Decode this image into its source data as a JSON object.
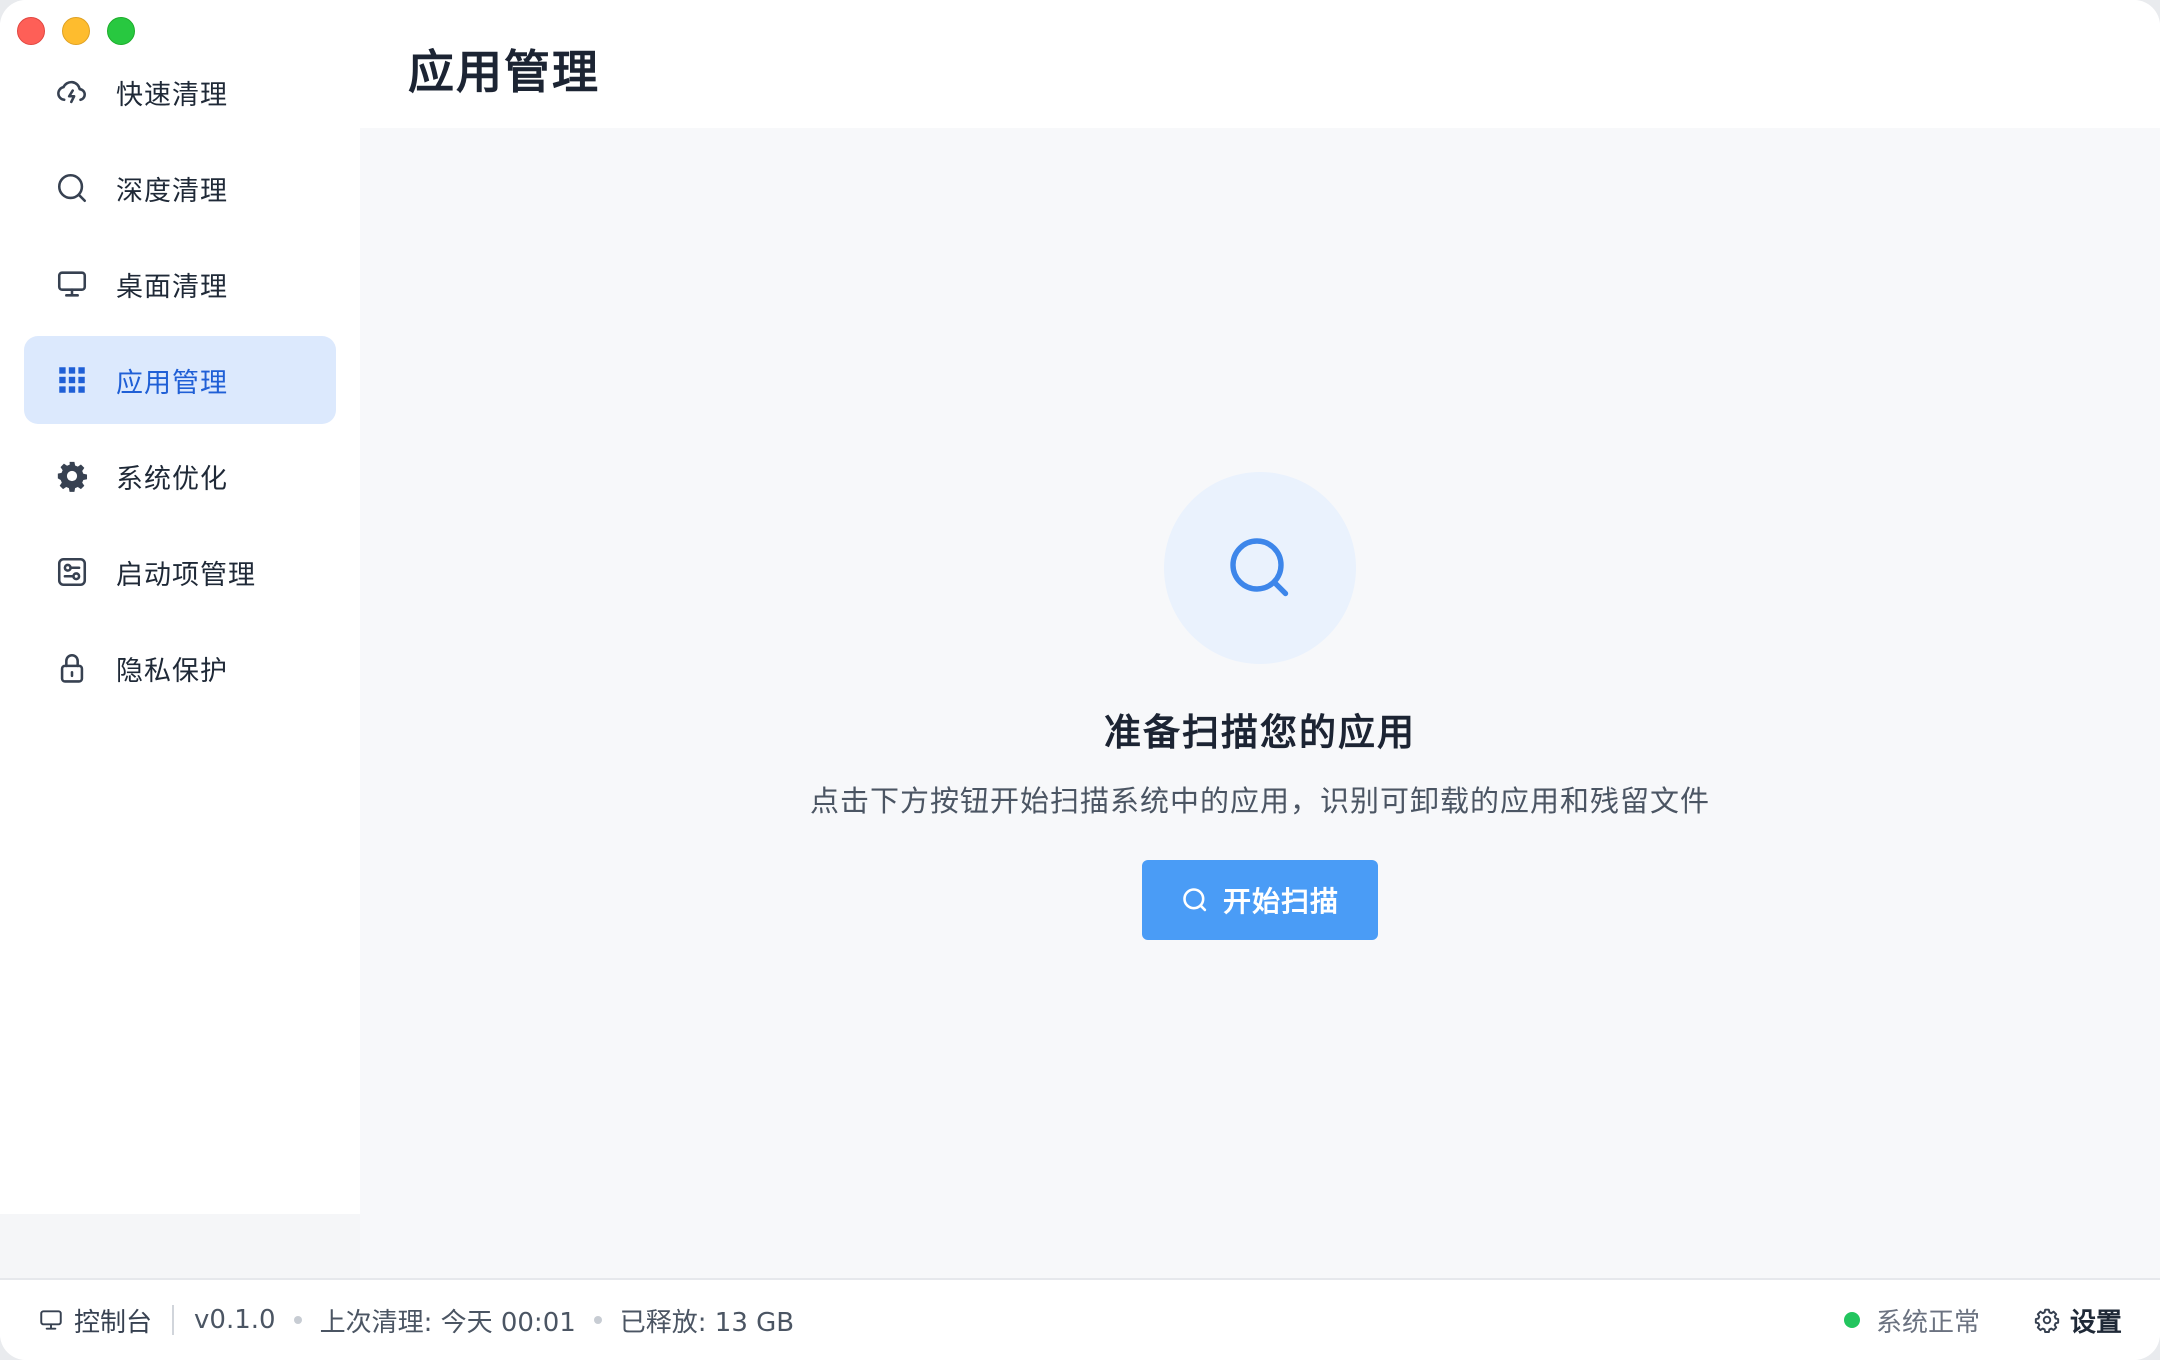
{
  "window": {
    "traffic_lights": [
      "close",
      "minimize",
      "maximize"
    ]
  },
  "sidebar": {
    "items": [
      {
        "label": "快速清理",
        "icon": "cloud-lightning-icon",
        "active": false
      },
      {
        "label": "深度清理",
        "icon": "search-icon",
        "active": false
      },
      {
        "label": "桌面清理",
        "icon": "monitor-icon",
        "active": false
      },
      {
        "label": "应用管理",
        "icon": "grid-icon",
        "active": true
      },
      {
        "label": "系统优化",
        "icon": "gear-icon",
        "active": false
      },
      {
        "label": "启动项管理",
        "icon": "sliders-icon",
        "active": false
      },
      {
        "label": "隐私保护",
        "icon": "lock-icon",
        "active": false
      }
    ]
  },
  "header": {
    "title": "应用管理"
  },
  "main": {
    "empty_title": "准备扫描您的应用",
    "empty_description": "点击下方按钮开始扫描系统中的应用，识别可卸载的应用和残留文件",
    "scan_button_label": "开始扫描",
    "empty_icon": "search-icon"
  },
  "statusbar": {
    "console_label": "控制台",
    "version": "v0.1.0",
    "last_clean": "上次清理: 今天 00:01",
    "freed": "已释放: 13 GB",
    "system_status": "系统正常",
    "settings_label": "设置"
  },
  "colors": {
    "accent": "#4a9cf6",
    "active_bg": "#dce9fd",
    "active_text": "#1f5fd6",
    "status_ok": "#22c55e"
  }
}
